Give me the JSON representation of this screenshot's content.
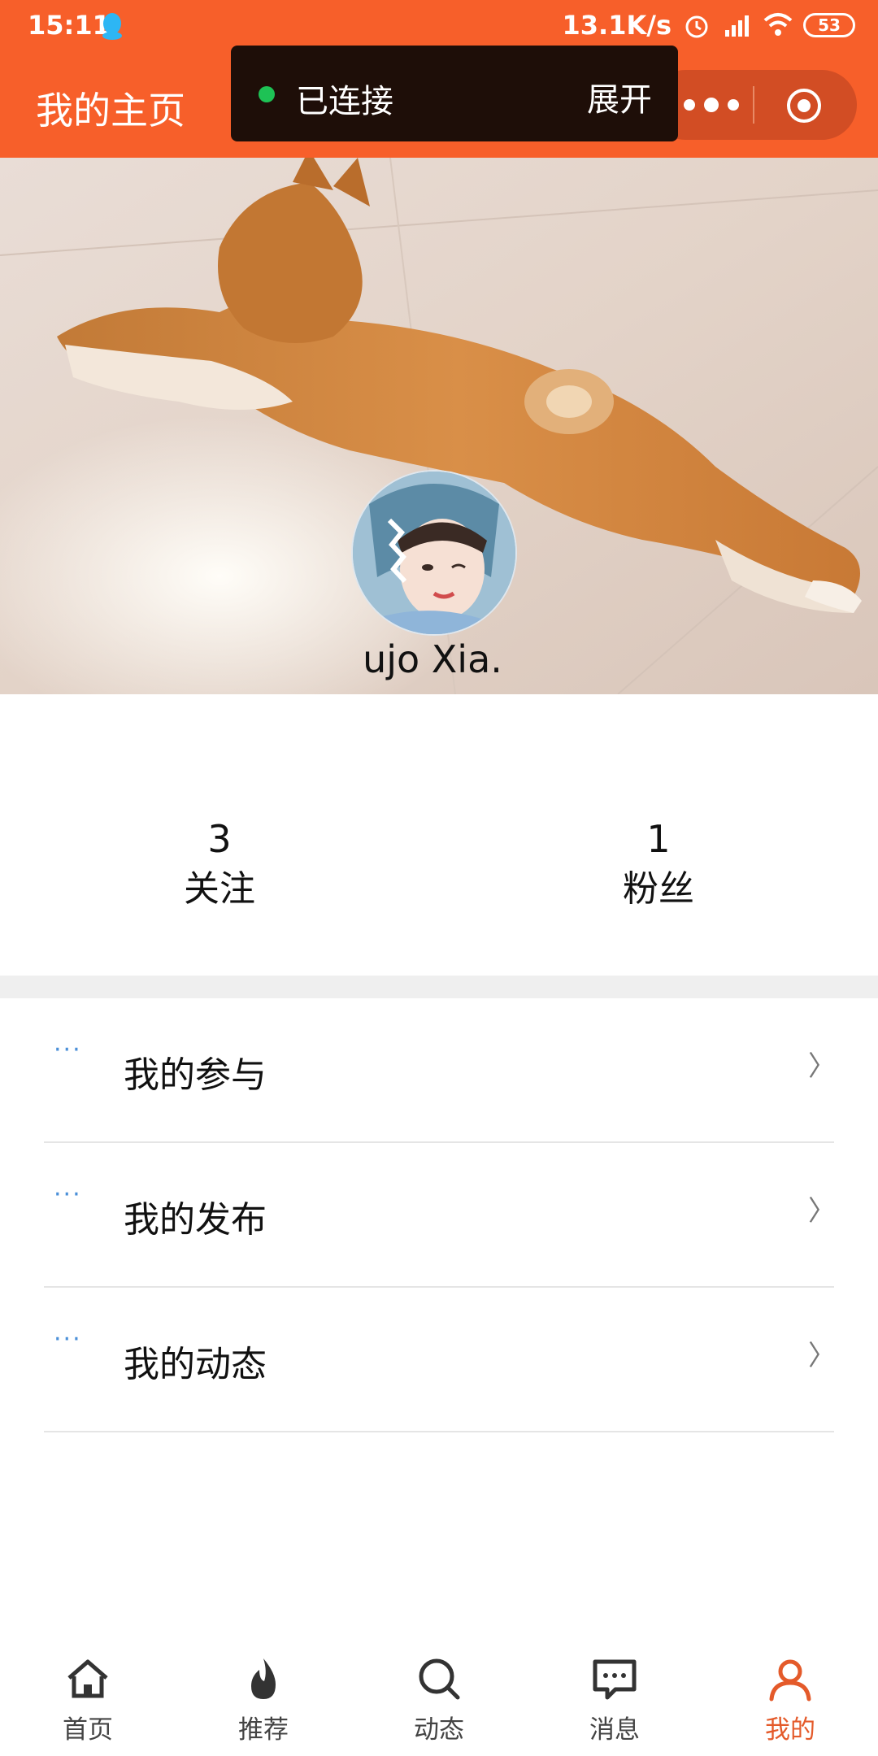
{
  "status_bar": {
    "time": "15:11",
    "net_speed": "13.1K/s",
    "battery": "53"
  },
  "header": {
    "title": "我的主页"
  },
  "connection": {
    "status": "已连接",
    "expand": "展开",
    "status_color": "#1ec255"
  },
  "profile": {
    "username": "ujo Xia."
  },
  "stats": [
    {
      "value": "3",
      "label": "关注"
    },
    {
      "value": "1",
      "label": "粉丝"
    }
  ],
  "menu": [
    {
      "label": "我的参与",
      "icon": "···"
    },
    {
      "label": "我的发布",
      "icon": "···"
    },
    {
      "label": "我的动态",
      "icon": "···"
    }
  ],
  "tabs": [
    {
      "label": "首页",
      "icon": "home-icon"
    },
    {
      "label": "推荐",
      "icon": "flame-icon"
    },
    {
      "label": "动态",
      "icon": "search-icon"
    },
    {
      "label": "消息",
      "icon": "message-icon"
    },
    {
      "label": "我的",
      "icon": "user-icon",
      "active": true
    }
  ],
  "colors": {
    "brand": "#f75f2a",
    "active_tab": "#e45a2a",
    "menu_icon": "#4a8fd8"
  }
}
